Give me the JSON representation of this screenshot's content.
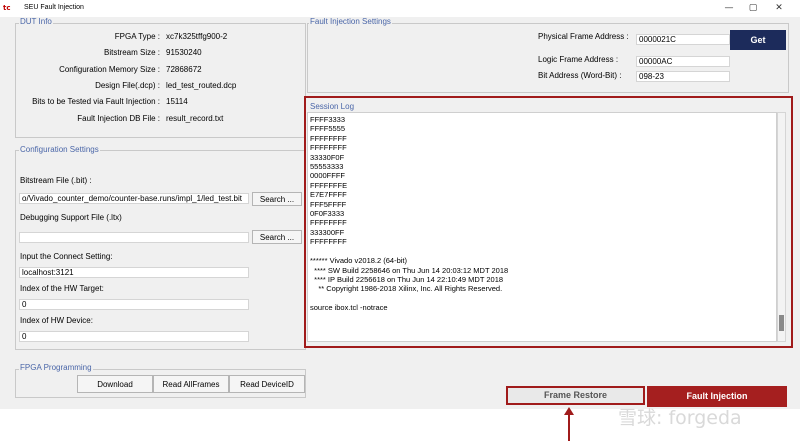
{
  "window": {
    "icon_text": "tc",
    "title": "SEU Fault Injection",
    "minimize_glyph": "—",
    "maximize_glyph": "▢",
    "close_glyph": "✕"
  },
  "dut_info": {
    "group_label": "DUT Info",
    "rows": [
      {
        "label": "FPGA Type :",
        "value": "xc7k325tffg900-2"
      },
      {
        "label": "Bitstream Size :",
        "value": "91530240"
      },
      {
        "label": "Configuration Memory Size :",
        "value": "72868672"
      },
      {
        "label": "Design File(.dcp) :",
        "value": "led_test_routed.dcp"
      },
      {
        "label": "Bits to be Tested via Fault Injection :",
        "value": "15114"
      },
      {
        "label": "Fault Injection DB File :",
        "value": "result_record.txt"
      }
    ]
  },
  "config": {
    "group_label": "Configuration Settings",
    "bitstream_label": "Bitstream File (.bit) :",
    "bitstream_value": "o/Vivado_counter_demo/counter-base.runs/impl_1/led_test.bit",
    "search_label": "Search ...",
    "debug_label": "Debugging Support File (.ltx)",
    "debug_value": "",
    "search2_label": "Search ...",
    "connect_label": "Input the Connect Setting:",
    "connect_value": "localhost:3121",
    "hw_target_label": "Index of the HW Target:",
    "hw_target_value": "0",
    "hw_device_label": "Index of HW Device:",
    "hw_device_value": "0"
  },
  "fpga_prog": {
    "group_label": "FPGA Programming",
    "download_label": "Download",
    "read_allframes_label": "Read AllFrames",
    "read_deviceid_label": "Read DeviceID"
  },
  "fault_settings": {
    "group_label": "Fault Injection Settings",
    "physical_label": "Physical Frame Address :",
    "physical_value": "0000021C",
    "logic_label": "Logic Frame Address :",
    "logic_value": "00000AC",
    "bit_label": "Bit Address (Word-Bit) :",
    "bit_value": "098-23",
    "get_label": "Get"
  },
  "session_log": {
    "group_label": "Session Log",
    "lines": [
      "FFFF3333",
      "FFFF5555",
      "FFFFFFFF",
      "FFFFFFFF",
      "33330F0F",
      "55553333",
      "0000FFFF",
      "FFFFFFFE",
      "E7E7FFFF",
      "FFF5FFFF",
      "0F0F3333",
      "FFFFFFFF",
      "333300FF",
      "FFFFFFFF",
      "",
      "****** Vivado v2018.2 (64-bit)",
      "  **** SW Build 2258646 on Thu Jun 14 20:03:12 MDT 2018",
      "  **** IP Build 2256618 on Thu Jun 14 22:10:49 MDT 2018",
      "    ** Copyright 1986-2018 Xilinx, Inc. All Rights Reserved.",
      "",
      "source ibox.tcl -notrace"
    ]
  },
  "actions": {
    "frame_restore_label": "Frame Restore",
    "fault_injection_label": "Fault Injection"
  },
  "watermark": {
    "text": "雪球: forgeda"
  },
  "colors": {
    "group_label": "#4a66a8",
    "highlight_red": "#a01b1b",
    "get_button": "#1c2b5b",
    "fault_button": "#a51f1f"
  }
}
